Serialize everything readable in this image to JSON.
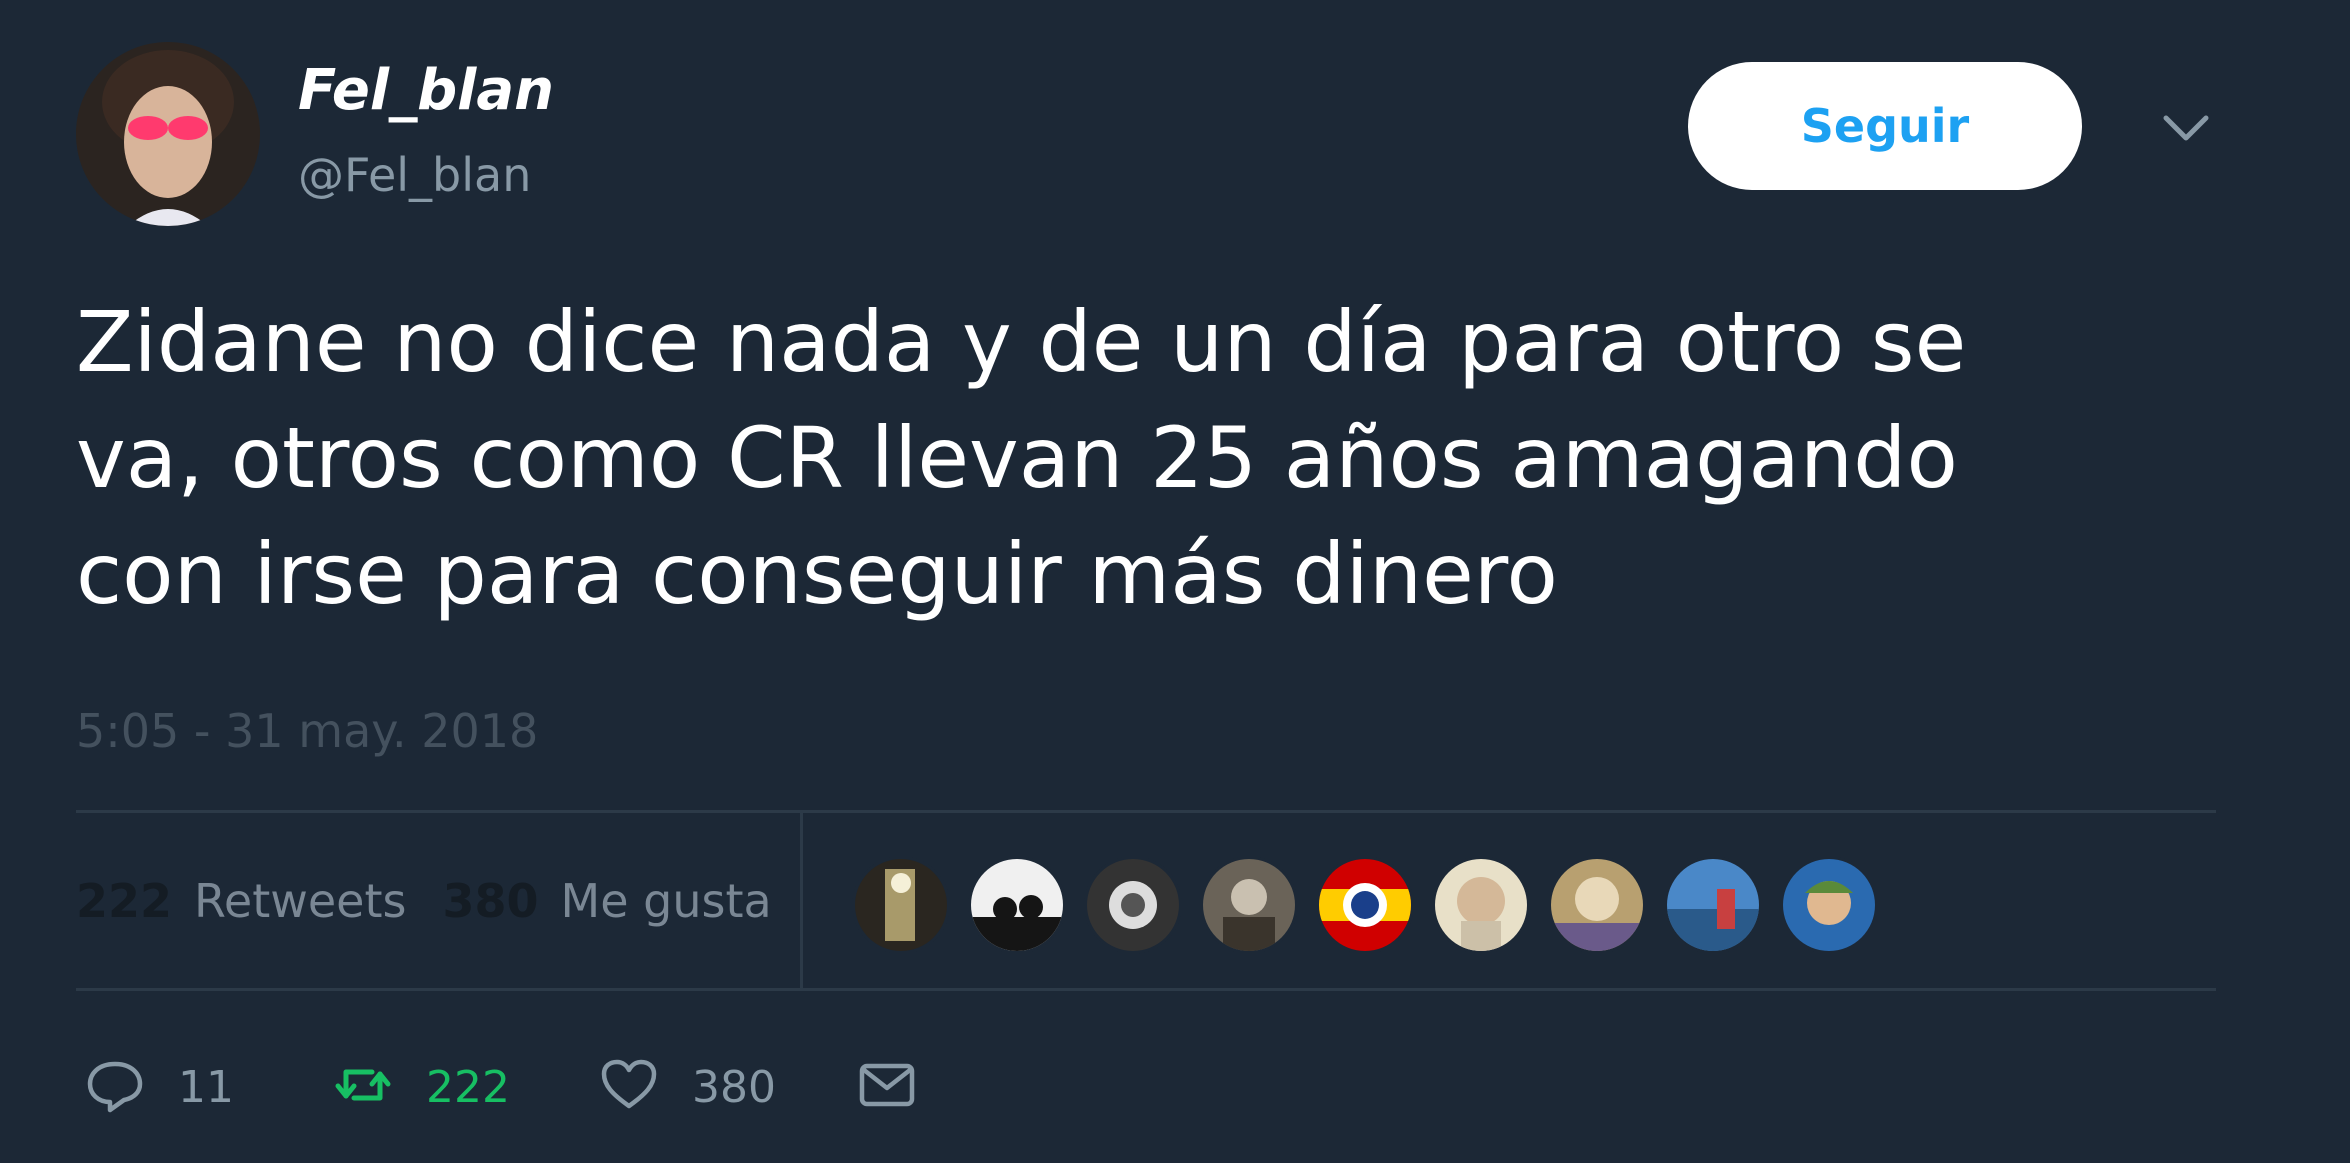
{
  "tweet": {
    "display_name": "Fel_blan",
    "handle": "@Fel_blan",
    "follow_label": "Seguir",
    "text_lines": [
      "Zidane no dice nada y de un día para otro se",
      "va, otros como CR llevan 25 años amagando",
      "con irse para conseguir más dinero"
    ],
    "timestamp": "5:05 - 31 may. 2018"
  },
  "stats": {
    "retweets_count": "222",
    "retweets_label": "Retweets",
    "likes_count": "380",
    "likes_label": "Me gusta"
  },
  "likers": [
    {
      "icon": "liker-avatar-1"
    },
    {
      "icon": "liker-avatar-2"
    },
    {
      "icon": "liker-avatar-3"
    },
    {
      "icon": "liker-avatar-4"
    },
    {
      "icon": "liker-avatar-5"
    },
    {
      "icon": "liker-avatar-6"
    },
    {
      "icon": "liker-avatar-7"
    },
    {
      "icon": "liker-avatar-8"
    },
    {
      "icon": "liker-avatar-9"
    }
  ],
  "actions": {
    "reply_count": "11",
    "retweet_count": "222",
    "like_count": "380"
  },
  "colors": {
    "background": "#1c2836",
    "accent": "#1da1f2",
    "retweet_green": "#17bf63",
    "muted": "#8899a6"
  }
}
